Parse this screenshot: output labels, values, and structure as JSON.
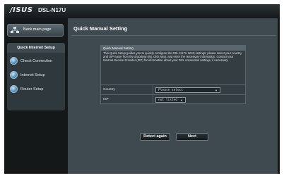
{
  "brand": {
    "logo": "/ISUS",
    "model": "DSL-N17U"
  },
  "sidebar": {
    "back_label": "Back main page",
    "section_title": "Quick Internet Setup",
    "items": [
      {
        "label": "Check Connection",
        "icon": "globe-icon"
      },
      {
        "label": "Internet Setup",
        "icon": "globe-icon"
      },
      {
        "label": "Router Setup",
        "icon": "globe-icon"
      }
    ]
  },
  "main": {
    "title": "Quick Manual Setting",
    "panel": {
      "header": "Quick Manual Setting",
      "description": "This Quick Setup guides you to quickly configure the DSL-N17U WAN settings; please select your country and ISP name from the dropdown list, click Next, and enter the necessary information. Contact your Internet Service Provider (ISP) for information about your DSL connection settings, if necessary.",
      "fields": [
        {
          "label": "Country",
          "value": "Please select"
        },
        {
          "label": "ISP",
          "value": "not listed"
        }
      ]
    },
    "buttons": {
      "detect": "Detect again",
      "next": "Next"
    }
  }
}
